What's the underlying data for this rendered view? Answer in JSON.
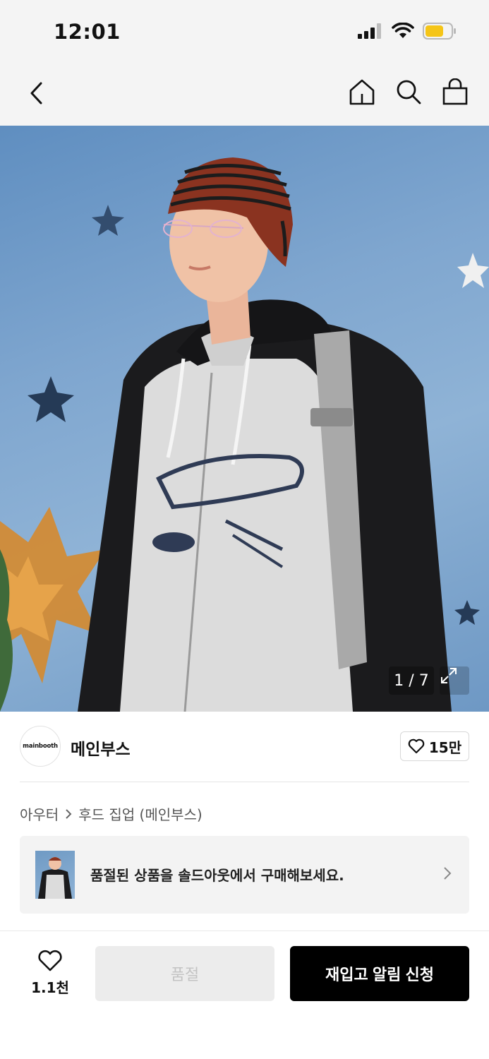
{
  "status_bar": {
    "time": "12:01"
  },
  "product_image": {
    "counter": "1 / 7"
  },
  "brand": {
    "logo_text": "mainbooth",
    "name": "메인부스",
    "likes": "15만"
  },
  "breadcrumb": {
    "category": "아우터",
    "subcategory": "후드 집업 (메인부스)"
  },
  "soldout_banner": {
    "text": "품절된 상품을 솔드아웃에서 구매해보세요."
  },
  "bottom_bar": {
    "wish_count": "1.1천",
    "soldout_label": "품절",
    "restock_label": "재입고 알림 신청"
  },
  "icons": {
    "status": [
      "signal-icon",
      "wifi-icon",
      "battery-icon"
    ],
    "nav": [
      "back-icon",
      "home-icon",
      "search-icon",
      "cart-icon"
    ],
    "misc": [
      "expand-icon",
      "heart-icon",
      "chevron-right-icon"
    ]
  },
  "colors": {
    "battery": "#f5c518",
    "cta": "#000000",
    "disabled": "#ececec",
    "background": "#f4f4f4"
  }
}
